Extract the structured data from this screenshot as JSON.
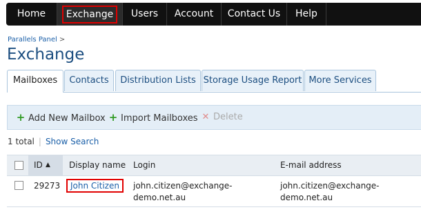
{
  "topnav": {
    "items": [
      {
        "label": "Home"
      },
      {
        "label": "Exchange"
      },
      {
        "label": "Users"
      },
      {
        "label": "Account"
      },
      {
        "label": "Contact Us"
      },
      {
        "label": "Help"
      }
    ],
    "selected": "Exchange"
  },
  "breadcrumb": {
    "item": "Parallels Panel",
    "separator": ">"
  },
  "page": {
    "title": "Exchange"
  },
  "tabs": [
    {
      "label": "Mailboxes"
    },
    {
      "label": "Contacts"
    },
    {
      "label": "Distribution Lists"
    },
    {
      "label": "Storage Usage Report"
    },
    {
      "label": "More Services"
    }
  ],
  "toolbar": {
    "add_label": "Add New Mailbox",
    "import_label": "Import Mailboxes",
    "delete_label": "Delete"
  },
  "summary": {
    "total": "1 total",
    "search_link": "Show Search"
  },
  "table": {
    "columns": [
      "ID",
      "Display name",
      "Login",
      "E-mail address"
    ],
    "sort_indicator": "▲",
    "rows": [
      {
        "id": "29273",
        "display_name": "John Citizen",
        "login_line1": "john.citizen@exchange-",
        "login_line2": "demo.net.au",
        "email_line1": "john.citizen@exchange-",
        "email_line2": "demo.net.au"
      }
    ]
  },
  "colors": {
    "nav_bg": "#111111",
    "title": "#1c4e80",
    "link": "#1a5fa8",
    "highlight": "#e10000"
  }
}
